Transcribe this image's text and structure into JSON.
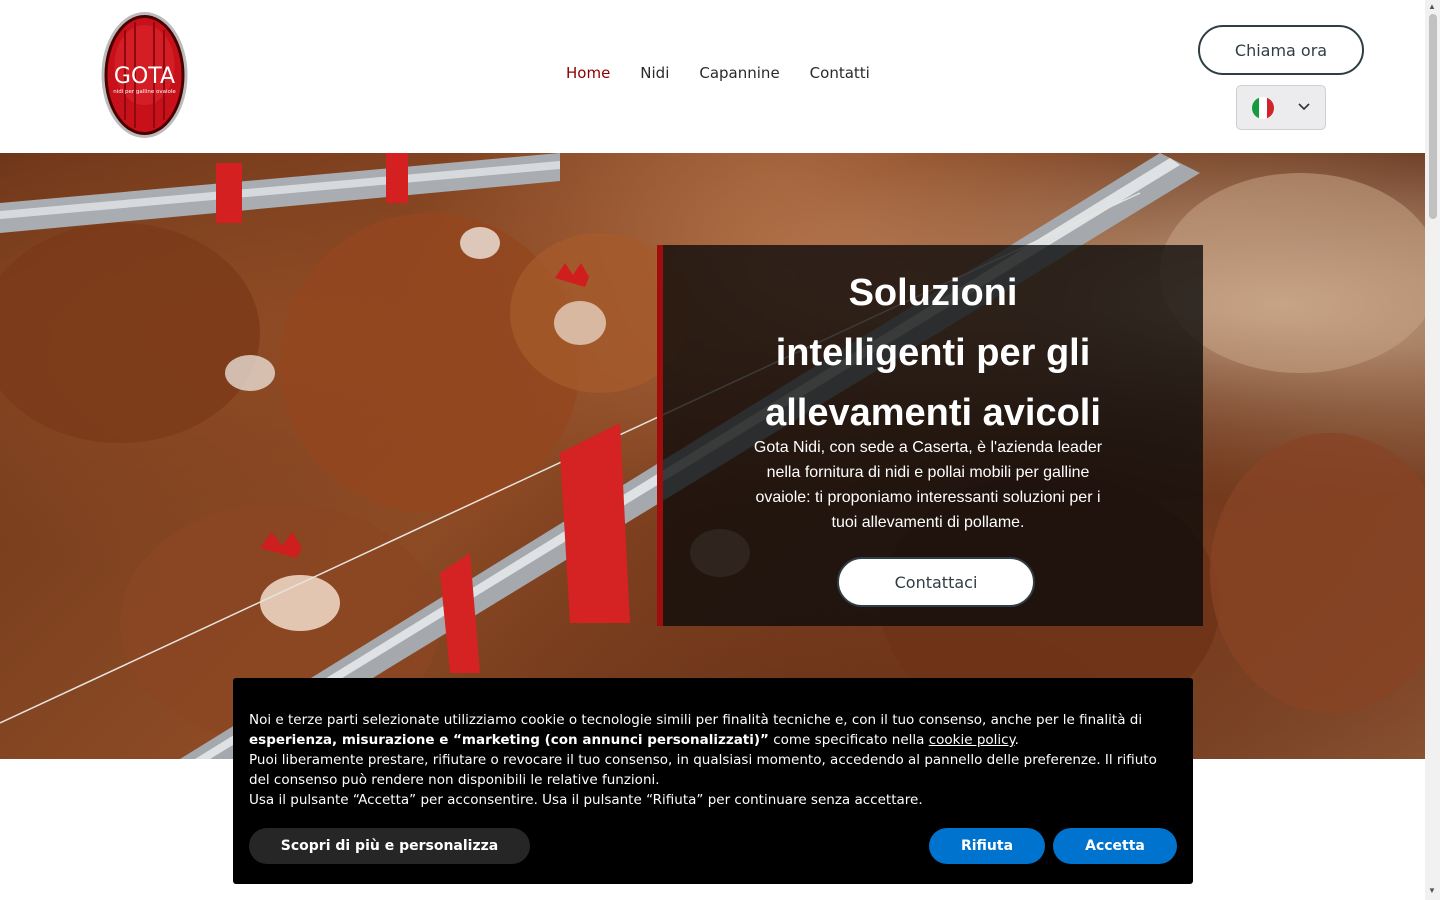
{
  "header": {
    "logo": {
      "brand": "GOTA",
      "tagline": "nidi per galline ovaiole"
    },
    "nav": [
      {
        "label": "Home",
        "active": true
      },
      {
        "label": "Nidi",
        "active": false
      },
      {
        "label": "Capannine",
        "active": false
      },
      {
        "label": "Contatti",
        "active": false
      }
    ],
    "call_button": "Chiama ora",
    "language": {
      "flag": "italy-flag-icon",
      "chevron": "chevron-down-icon"
    }
  },
  "hero": {
    "title_lines": [
      "Soluzioni",
      "intelligenti per gli",
      "allevamenti avicoli"
    ],
    "text": "Gota Nidi, con sede a Caserta, è l'azienda leader nella fornitura di nidi e pollai mobili per galline ovaiole: ti proponiamo interessanti soluzioni per i tuoi allevamenti di pollame.",
    "button": "Contattaci"
  },
  "cookie": {
    "p1_start": "Noi e terze parti selezionate utilizziamo cookie o tecnologie simili per finalità tecniche e, con il tuo consenso, anche per le finalità di ",
    "p1_bold": "esperienza, misurazione e “marketing (con annunci personalizzati)”",
    "p1_mid": " come specificato nella ",
    "p1_link": "cookie policy",
    "p1_end": ".",
    "p2": "Puoi liberamente prestare, rifiutare o revocare il tuo consenso, in qualsiasi momento, accedendo al pannello delle preferenze. Il rifiuto del consenso può rendere non disponibili le relative funzioni.",
    "p3": "Usa il pulsante “Accetta” per acconsentire. Usa il pulsante “Rifiuta” per continuare senza accettare.",
    "btn_more": "Scopri di più e personalizza",
    "btn_reject": "Rifiuta",
    "btn_accept": "Accetta"
  },
  "colors": {
    "accent": "#8b0000",
    "cookie_button": "#0073ce",
    "dark_border": "#2f3d44"
  }
}
